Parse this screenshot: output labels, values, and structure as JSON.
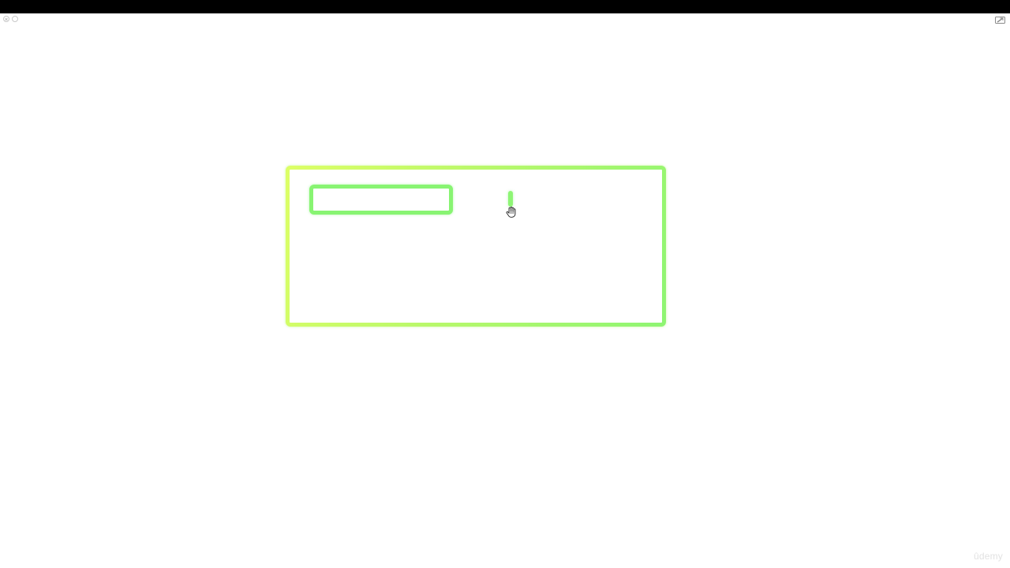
{
  "window": {
    "controls": [
      {
        "name": "close",
        "icon": "close-circle-icon"
      },
      {
        "name": "minimize",
        "icon": "circle-icon"
      }
    ],
    "pip_icon": "picture-in-picture-icon"
  },
  "canvas": {
    "outer_frame_colors": [
      "#ddff66",
      "#8ef572"
    ],
    "inner_box_color": "#88f472",
    "caret_color": "#8ef575",
    "cursor_icon": "hand-pointer-icon"
  },
  "watermark": {
    "text": "ûdemy"
  }
}
